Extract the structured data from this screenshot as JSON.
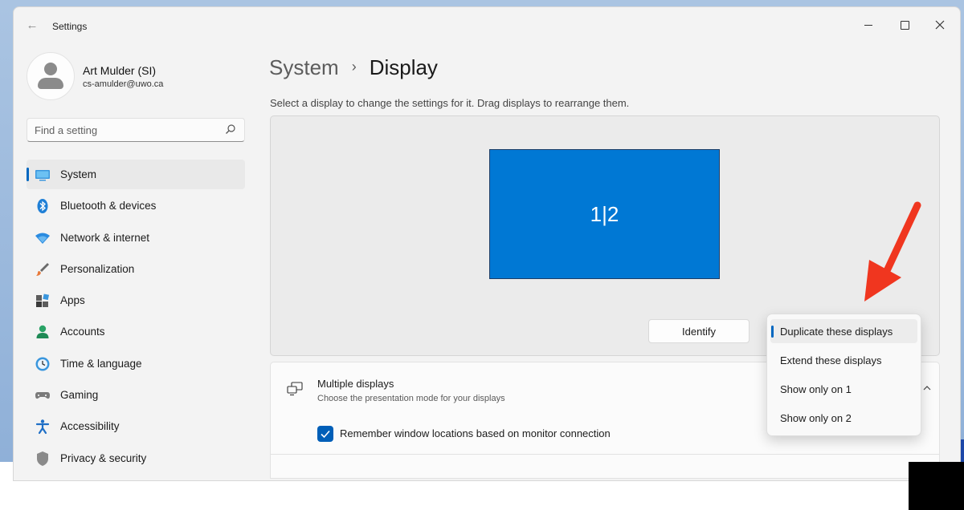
{
  "window": {
    "app_title": "Settings"
  },
  "profile": {
    "name": "Art Mulder (SI)",
    "email": "cs-amulder@uwo.ca"
  },
  "search": {
    "placeholder": "Find a setting"
  },
  "nav": {
    "items": [
      {
        "label": "System",
        "icon": "monitor-icon",
        "active": true
      },
      {
        "label": "Bluetooth & devices",
        "icon": "bluetooth-icon"
      },
      {
        "label": "Network & internet",
        "icon": "wifi-icon"
      },
      {
        "label": "Personalization",
        "icon": "brush-icon"
      },
      {
        "label": "Apps",
        "icon": "apps-icon"
      },
      {
        "label": "Accounts",
        "icon": "person-icon"
      },
      {
        "label": "Time & language",
        "icon": "clock-globe-icon"
      },
      {
        "label": "Gaming",
        "icon": "gamepad-icon"
      },
      {
        "label": "Accessibility",
        "icon": "accessibility-icon"
      },
      {
        "label": "Privacy & security",
        "icon": "shield-icon"
      }
    ]
  },
  "main": {
    "breadcrumb_parent": "System",
    "breadcrumb_separator": "›",
    "breadcrumb_current": "Display",
    "subtitle": "Select a display to change the settings for it. Drag displays to rearrange them.",
    "monitor_label": "1|2",
    "identify_label": "Identify",
    "multiple_displays": {
      "title": "Multiple displays",
      "description": "Choose the presentation mode for your displays"
    },
    "remember_label": "Remember window locations based on monitor connection",
    "remember_checked": true
  },
  "dropdown": {
    "options": [
      "Duplicate these displays",
      "Extend these displays",
      "Show only on 1",
      "Show only on 2"
    ],
    "selected_index": 0
  },
  "colors": {
    "accent": "#0067c0",
    "monitor_fill": "#0078d4",
    "annotation_arrow": "#f0361f"
  }
}
